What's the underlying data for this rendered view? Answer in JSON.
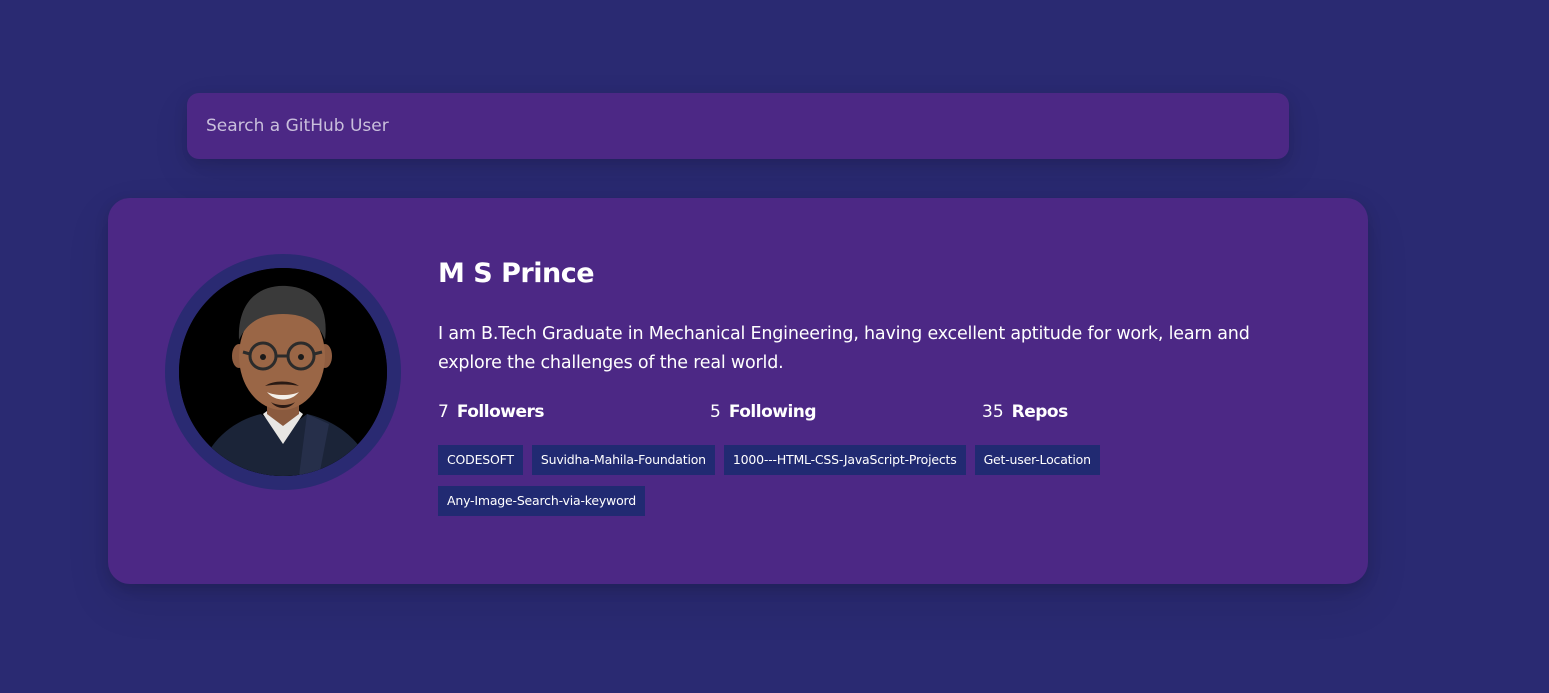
{
  "search": {
    "placeholder": "Search a GitHub User"
  },
  "profile": {
    "name": "M S Prince",
    "bio": "I am B.Tech Graduate in Mechanical Engineering, having excellent aptitude for work, learn and explore the challenges of the real world.",
    "avatar_icon": "user-avatar-photo",
    "stats": [
      {
        "value": "7",
        "label": "Followers"
      },
      {
        "value": "5",
        "label": "Following"
      },
      {
        "value": "35",
        "label": "Repos"
      }
    ],
    "repos": [
      "CODESOFT",
      "Suvidha-Mahila-Foundation",
      "1000---HTML-CSS-JavaScript-Projects",
      "Get-user-Location",
      "Any-Image-Search-via-keyword"
    ]
  },
  "colors": {
    "background": "#2a2a72",
    "card": "#4c2885",
    "repo_tag": "#212a72",
    "avatar_ring": "#2a2a72"
  }
}
